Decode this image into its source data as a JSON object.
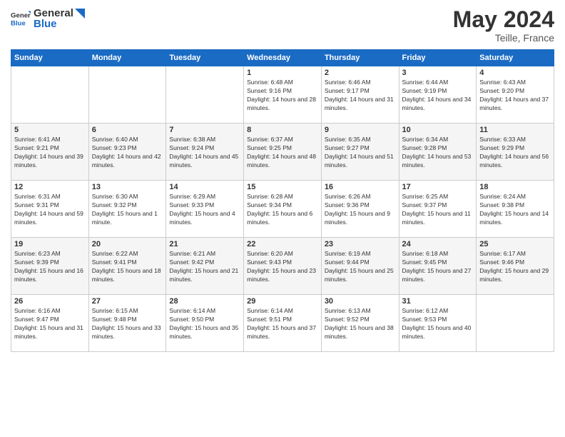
{
  "header": {
    "logo_general": "General",
    "logo_blue": "Blue",
    "month_year": "May 2024",
    "location": "Teille, France"
  },
  "weekdays": [
    "Sunday",
    "Monday",
    "Tuesday",
    "Wednesday",
    "Thursday",
    "Friday",
    "Saturday"
  ],
  "weeks": [
    [
      {
        "day": "",
        "sunrise": "",
        "sunset": "",
        "daylight": ""
      },
      {
        "day": "",
        "sunrise": "",
        "sunset": "",
        "daylight": ""
      },
      {
        "day": "",
        "sunrise": "",
        "sunset": "",
        "daylight": ""
      },
      {
        "day": "1",
        "sunrise": "Sunrise: 6:48 AM",
        "sunset": "Sunset: 9:16 PM",
        "daylight": "Daylight: 14 hours and 28 minutes."
      },
      {
        "day": "2",
        "sunrise": "Sunrise: 6:46 AM",
        "sunset": "Sunset: 9:17 PM",
        "daylight": "Daylight: 14 hours and 31 minutes."
      },
      {
        "day": "3",
        "sunrise": "Sunrise: 6:44 AM",
        "sunset": "Sunset: 9:19 PM",
        "daylight": "Daylight: 14 hours and 34 minutes."
      },
      {
        "day": "4",
        "sunrise": "Sunrise: 6:43 AM",
        "sunset": "Sunset: 9:20 PM",
        "daylight": "Daylight: 14 hours and 37 minutes."
      }
    ],
    [
      {
        "day": "5",
        "sunrise": "Sunrise: 6:41 AM",
        "sunset": "Sunset: 9:21 PM",
        "daylight": "Daylight: 14 hours and 39 minutes."
      },
      {
        "day": "6",
        "sunrise": "Sunrise: 6:40 AM",
        "sunset": "Sunset: 9:23 PM",
        "daylight": "Daylight: 14 hours and 42 minutes."
      },
      {
        "day": "7",
        "sunrise": "Sunrise: 6:38 AM",
        "sunset": "Sunset: 9:24 PM",
        "daylight": "Daylight: 14 hours and 45 minutes."
      },
      {
        "day": "8",
        "sunrise": "Sunrise: 6:37 AM",
        "sunset": "Sunset: 9:25 PM",
        "daylight": "Daylight: 14 hours and 48 minutes."
      },
      {
        "day": "9",
        "sunrise": "Sunrise: 6:35 AM",
        "sunset": "Sunset: 9:27 PM",
        "daylight": "Daylight: 14 hours and 51 minutes."
      },
      {
        "day": "10",
        "sunrise": "Sunrise: 6:34 AM",
        "sunset": "Sunset: 9:28 PM",
        "daylight": "Daylight: 14 hours and 53 minutes."
      },
      {
        "day": "11",
        "sunrise": "Sunrise: 6:33 AM",
        "sunset": "Sunset: 9:29 PM",
        "daylight": "Daylight: 14 hours and 56 minutes."
      }
    ],
    [
      {
        "day": "12",
        "sunrise": "Sunrise: 6:31 AM",
        "sunset": "Sunset: 9:31 PM",
        "daylight": "Daylight: 14 hours and 59 minutes."
      },
      {
        "day": "13",
        "sunrise": "Sunrise: 6:30 AM",
        "sunset": "Sunset: 9:32 PM",
        "daylight": "Daylight: 15 hours and 1 minute."
      },
      {
        "day": "14",
        "sunrise": "Sunrise: 6:29 AM",
        "sunset": "Sunset: 9:33 PM",
        "daylight": "Daylight: 15 hours and 4 minutes."
      },
      {
        "day": "15",
        "sunrise": "Sunrise: 6:28 AM",
        "sunset": "Sunset: 9:34 PM",
        "daylight": "Daylight: 15 hours and 6 minutes."
      },
      {
        "day": "16",
        "sunrise": "Sunrise: 6:26 AM",
        "sunset": "Sunset: 9:36 PM",
        "daylight": "Daylight: 15 hours and 9 minutes."
      },
      {
        "day": "17",
        "sunrise": "Sunrise: 6:25 AM",
        "sunset": "Sunset: 9:37 PM",
        "daylight": "Daylight: 15 hours and 11 minutes."
      },
      {
        "day": "18",
        "sunrise": "Sunrise: 6:24 AM",
        "sunset": "Sunset: 9:38 PM",
        "daylight": "Daylight: 15 hours and 14 minutes."
      }
    ],
    [
      {
        "day": "19",
        "sunrise": "Sunrise: 6:23 AM",
        "sunset": "Sunset: 9:39 PM",
        "daylight": "Daylight: 15 hours and 16 minutes."
      },
      {
        "day": "20",
        "sunrise": "Sunrise: 6:22 AM",
        "sunset": "Sunset: 9:41 PM",
        "daylight": "Daylight: 15 hours and 18 minutes."
      },
      {
        "day": "21",
        "sunrise": "Sunrise: 6:21 AM",
        "sunset": "Sunset: 9:42 PM",
        "daylight": "Daylight: 15 hours and 21 minutes."
      },
      {
        "day": "22",
        "sunrise": "Sunrise: 6:20 AM",
        "sunset": "Sunset: 9:43 PM",
        "daylight": "Daylight: 15 hours and 23 minutes."
      },
      {
        "day": "23",
        "sunrise": "Sunrise: 6:19 AM",
        "sunset": "Sunset: 9:44 PM",
        "daylight": "Daylight: 15 hours and 25 minutes."
      },
      {
        "day": "24",
        "sunrise": "Sunrise: 6:18 AM",
        "sunset": "Sunset: 9:45 PM",
        "daylight": "Daylight: 15 hours and 27 minutes."
      },
      {
        "day": "25",
        "sunrise": "Sunrise: 6:17 AM",
        "sunset": "Sunset: 9:46 PM",
        "daylight": "Daylight: 15 hours and 29 minutes."
      }
    ],
    [
      {
        "day": "26",
        "sunrise": "Sunrise: 6:16 AM",
        "sunset": "Sunset: 9:47 PM",
        "daylight": "Daylight: 15 hours and 31 minutes."
      },
      {
        "day": "27",
        "sunrise": "Sunrise: 6:15 AM",
        "sunset": "Sunset: 9:48 PM",
        "daylight": "Daylight: 15 hours and 33 minutes."
      },
      {
        "day": "28",
        "sunrise": "Sunrise: 6:14 AM",
        "sunset": "Sunset: 9:50 PM",
        "daylight": "Daylight: 15 hours and 35 minutes."
      },
      {
        "day": "29",
        "sunrise": "Sunrise: 6:14 AM",
        "sunset": "Sunset: 9:51 PM",
        "daylight": "Daylight: 15 hours and 37 minutes."
      },
      {
        "day": "30",
        "sunrise": "Sunrise: 6:13 AM",
        "sunset": "Sunset: 9:52 PM",
        "daylight": "Daylight: 15 hours and 38 minutes."
      },
      {
        "day": "31",
        "sunrise": "Sunrise: 6:12 AM",
        "sunset": "Sunset: 9:53 PM",
        "daylight": "Daylight: 15 hours and 40 minutes."
      },
      {
        "day": "",
        "sunrise": "",
        "sunset": "",
        "daylight": ""
      }
    ]
  ]
}
